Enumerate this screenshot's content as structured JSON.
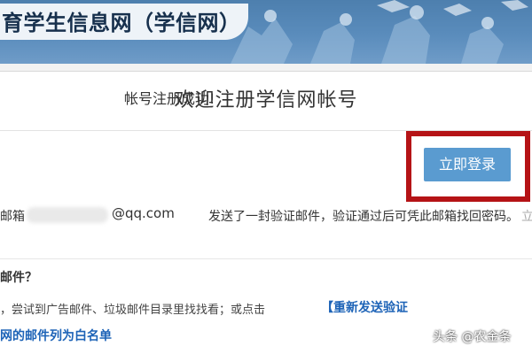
{
  "banner": {
    "title": "育学生信息网（学信网）"
  },
  "panel": {
    "heading": "欢迎注册学信网帐号",
    "success_message": "帐号注册成功!",
    "login_button": "立即登录",
    "mail_line": {
      "prefix": "邮箱",
      "domain": "@qq.com",
      "message": "发送了一封验证邮件，验证通过后可凭此邮箱找回密码。",
      "tail": "立"
    },
    "help": {
      "heading": "邮件？",
      "tip": "，尝试到广告邮件、垃圾邮件目录里找找看；或点击",
      "resend_bracket": "【",
      "resend_link": "重新发送验证",
      "whitelist_link": "网的邮件列为白名单"
    }
  },
  "watermark": "头条 @农金条",
  "colors": {
    "banner": "#5a8cbc",
    "button": "#5a9bd0",
    "highlight_border": "#b51316",
    "link": "#1d63b7"
  }
}
